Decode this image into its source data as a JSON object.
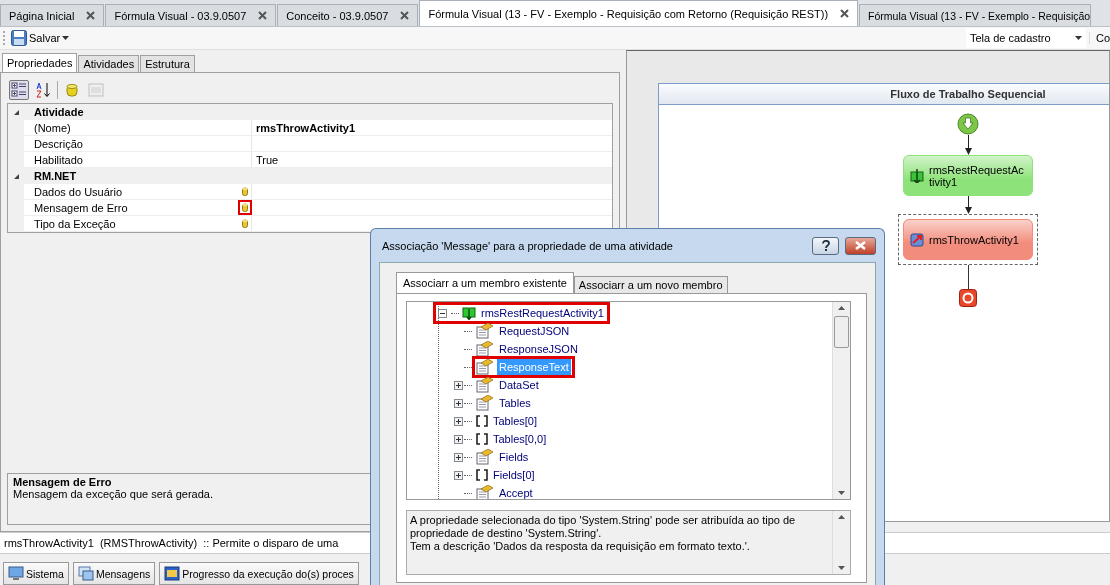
{
  "document_tabs": [
    {
      "label": "Página Inicial",
      "selected": false,
      "closable": true
    },
    {
      "label": "Fórmula Visual - 03.9.0507",
      "selected": false,
      "closable": true
    },
    {
      "label": "Conceito - 03.9.0507",
      "selected": false,
      "closable": true
    },
    {
      "label": "Fórmula Visual (13 - FV - Exemplo - Requisição com Retorno (Requisição REST))",
      "selected": true,
      "closable": true
    },
    {
      "label": "Fórmula Visual (13 - FV - Exemplo - Requisição",
      "selected": false,
      "closable": false
    }
  ],
  "toolbar": {
    "save_label": "Salvar",
    "view_select": "Tela de cadastro",
    "cut_item": "Co"
  },
  "properties_panel": {
    "tabs": [
      {
        "label": "Propriedades",
        "selected": true
      },
      {
        "label": "Atividades",
        "selected": false
      },
      {
        "label": "Estrutura",
        "selected": false
      }
    ],
    "grid_toolbar": [
      {
        "kind": "categorized",
        "pressed": true,
        "disabled": false
      },
      {
        "kind": "alphabetical",
        "pressed": false,
        "disabled": false
      },
      {
        "kind": "database",
        "pressed": false,
        "disabled": false
      },
      {
        "kind": "pages",
        "pressed": false,
        "disabled": true
      }
    ],
    "categories": [
      {
        "name": "Atividade",
        "expanded": true,
        "rows": [
          {
            "kind": "name",
            "name": "(Nome)",
            "value": "rmsThrowActivity1",
            "highlighted": false
          },
          {
            "kind": "text",
            "name": "Descrição",
            "highlighted": false
          },
          {
            "kind": "text",
            "name": "Habilitado",
            "value": "True",
            "highlighted": false
          }
        ]
      },
      {
        "name": "RM.NET",
        "expanded": true,
        "rows": [
          {
            "kind": "binding",
            "name": "Dados do Usuário",
            "highlighted": false
          },
          {
            "kind": "binding",
            "name": "Mensagem de Erro",
            "highlighted": true
          },
          {
            "kind": "binding",
            "name": "Tipo da Exceção",
            "highlighted": false
          }
        ]
      }
    ],
    "description": {
      "title": "Mensagem de Erro",
      "text": "Mensagem da exceção que será gerada."
    }
  },
  "designer": {
    "title": "Fluxo de Trabalho Sequencial",
    "nodes": [
      {
        "kind": "start"
      },
      {
        "kind": "request_activity",
        "label": "rmsRestRequestActivity1",
        "color": "#8ee27a",
        "selected": false
      },
      {
        "kind": "throw_activity",
        "label": "rmsThrowActivity1",
        "color": "#f28c7c",
        "selected": true
      },
      {
        "kind": "end"
      }
    ]
  },
  "status_line": "rmsThrowActivity1  (RMSThrowActivity)  :: Permite o disparo de uma",
  "taskbar": [
    {
      "kind": "system",
      "label": "Sistema"
    },
    {
      "kind": "messages",
      "label": "Mensagens"
    },
    {
      "kind": "progress",
      "label": "Progresso da execução do(s) proces"
    }
  ],
  "dialog": {
    "title": "Associação 'Message' para a propriedade de uma atividade",
    "tabs": [
      {
        "label": "Associarr a um membro existente",
        "selected": true
      },
      {
        "label": "Associarr a um novo membro",
        "selected": false
      }
    ],
    "tree": [
      {
        "label": "rmsRestRequestActivity1",
        "kind": "activity",
        "expandable": true,
        "expanded": true,
        "selected": false,
        "highlighted": true,
        "children": [
          {
            "label": "RequestJSON",
            "kind": "property",
            "expandable": false,
            "selected": false,
            "highlighted": false
          },
          {
            "label": "ResponseJSON",
            "kind": "property",
            "expandable": false,
            "selected": false,
            "highlighted": false
          },
          {
            "label": "ResponseText",
            "kind": "property",
            "expandable": false,
            "selected": true,
            "highlighted": true
          },
          {
            "label": "DataSet",
            "kind": "property",
            "expandable": true,
            "expanded": false,
            "selected": false,
            "highlighted": false
          },
          {
            "label": "Tables",
            "kind": "property",
            "expandable": true,
            "expanded": false,
            "selected": false,
            "highlighted": false
          },
          {
            "label": "Tables[0]",
            "kind": "array",
            "expandable": true,
            "expanded": false,
            "selected": false,
            "highlighted": false
          },
          {
            "label": "Tables[0,0]",
            "kind": "array",
            "expandable": true,
            "expanded": false,
            "selected": false,
            "highlighted": false
          },
          {
            "label": "Fields",
            "kind": "property",
            "expandable": true,
            "expanded": false,
            "selected": false,
            "highlighted": false
          },
          {
            "label": "Fields[0]",
            "kind": "array",
            "expandable": true,
            "expanded": false,
            "selected": false,
            "highlighted": false
          },
          {
            "label": "Accept",
            "kind": "property",
            "expandable": false,
            "selected": false,
            "highlighted": false
          }
        ]
      }
    ],
    "description": [
      "A propriedade selecionada do tipo 'System.String' pode ser atribuída ao tipo de propriedade de destino 'System.String'.",
      "Tem a descrição 'Dados da resposta da requisição em formato texto.'."
    ]
  }
}
